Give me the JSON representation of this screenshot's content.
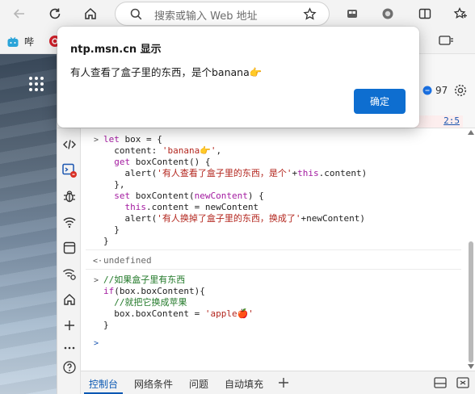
{
  "browser": {
    "address_placeholder": "搜索或输入 Web 地址",
    "bookmark_1_label": "哔"
  },
  "devtools": {
    "badge_count": "97",
    "partial_source_link": "2:5",
    "tabs": [
      {
        "label": "控制台"
      },
      {
        "label": "网络条件"
      },
      {
        "label": "问题"
      },
      {
        "label": "自动填充"
      }
    ]
  },
  "console": {
    "lines": {
      "l1a": "let",
      "l1b": " box = {",
      "l2a": "  content: ",
      "l2b": "'banana👉'",
      "l2c": ",",
      "l3a": "  get",
      "l3b": " boxContent() {",
      "l4a": "    alert(",
      "l4b": "'有人查看了盒子里的东西，是个'",
      "l4c": "+",
      "l4d": "this",
      "l4e": ".content)",
      "l5": "  },",
      "l6a": "  set",
      "l6b": " boxContent(",
      "l6c": "newContent",
      "l6d": ") {",
      "l7a": "    this",
      "l7b": ".content = newContent",
      "l8a": "    alert(",
      "l8b": "'有人换掉了盒子里的东西，换成了'",
      "l8c": "+newContent)",
      "l9": "  }",
      "l10": "}",
      "result": "undefined",
      "c1": "//如果盒子里有东西",
      "c2a": "if",
      "c2b": "(box.boxContent){",
      "c3": "  //就把它换成苹果",
      "c4a": "  box.boxContent = ",
      "c4b": "'apple🍎'",
      "c5": "}"
    }
  },
  "dialog": {
    "title": "ntp.msn.cn 显示",
    "message": "有人查看了盒子里的东西，是个banana👉",
    "ok_label": "确定"
  },
  "colors": {
    "accent": "#0e6ed0",
    "keyword": "#a31ba0",
    "string": "#b3261e",
    "comment": "#237a2a"
  }
}
